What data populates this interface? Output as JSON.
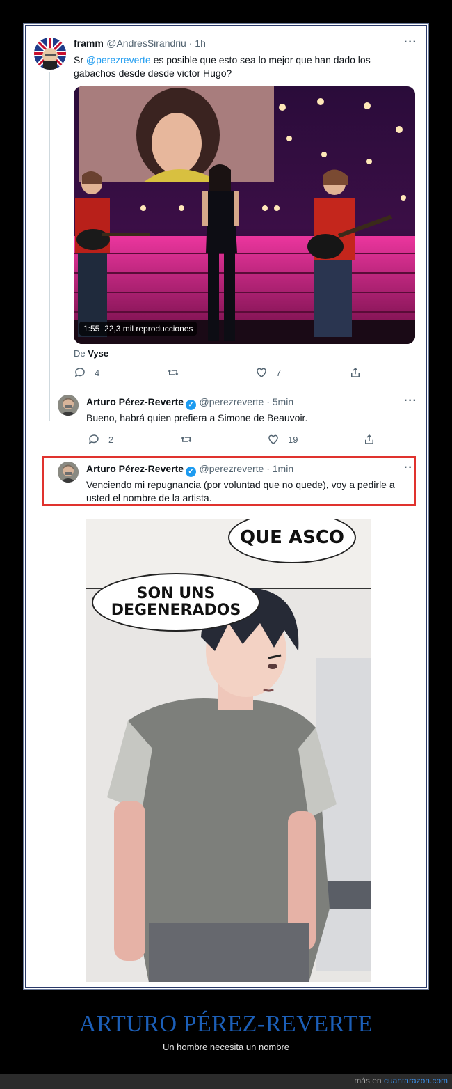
{
  "tweet1": {
    "name": "framm",
    "handle": "@AndresSirandriu · 1h",
    "text_pre": "Sr ",
    "mention": "@perezreverte",
    "text_post": " es posible que esto sea lo mejor que han dado los gabachos desde desde victor Hugo?",
    "video_time": "1:55",
    "video_views": "22,3 mil reproducciones",
    "source_prefix": "De ",
    "source_name": "Vyse",
    "replies": "4",
    "likes": "7",
    "more": "···"
  },
  "tweet2": {
    "name": "Arturo Pérez-Reverte",
    "handle": "@perezreverte · 5min",
    "text": "Bueno, habrá quien prefiera a Simone de Beauvoir.",
    "replies": "2",
    "likes": "19",
    "more": "···"
  },
  "tweet3": {
    "name": "Arturo Pérez-Reverte",
    "handle": "@perezreverte · 1min",
    "text": "Venciendo mi repugnancia (por voluntad que no quede), voy a pedirle a usted el nombre de la artista.",
    "more": "··"
  },
  "meme": {
    "bubble1": "QUE ASCO",
    "bubble2_line1": "SON UNS",
    "bubble2_line2": "DEGENERADOS"
  },
  "footer": {
    "title": "ARTURO PÉREZ-REVERTE",
    "subtitle": "Un hombre necesita un nombre",
    "link_prefix": "más en ",
    "link_site": "cuantarazon.com"
  },
  "colors": {
    "accent": "#1d9bf0",
    "highlight": "#e0322e",
    "footer_title": "#1c5fb8"
  }
}
